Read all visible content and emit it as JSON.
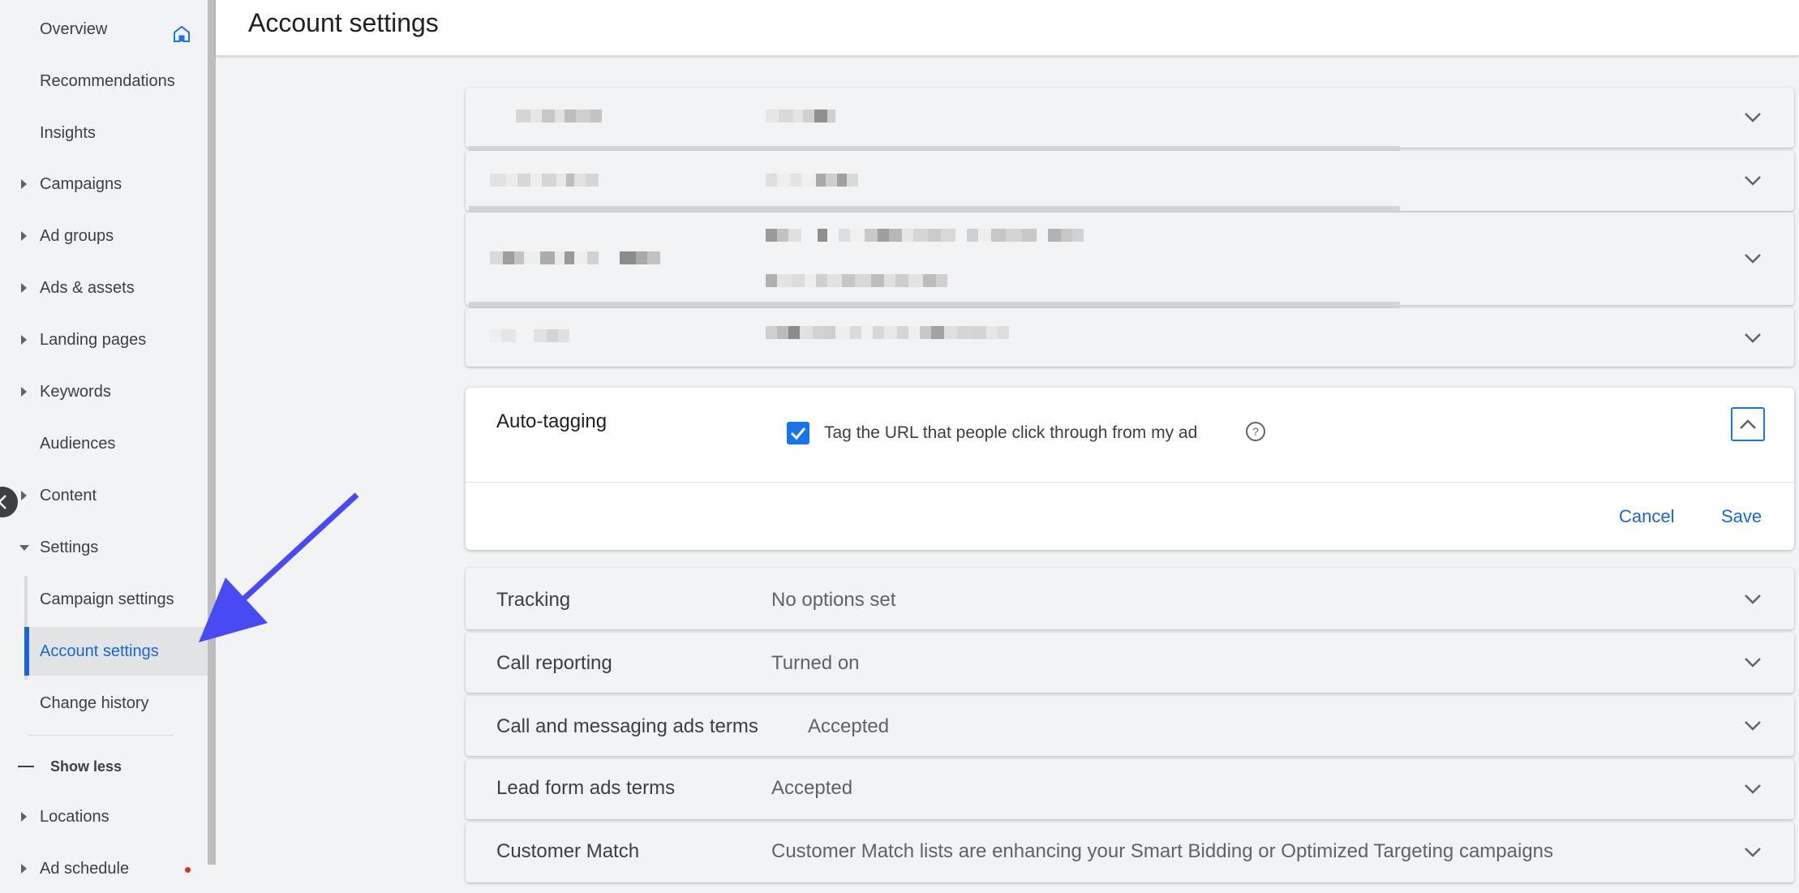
{
  "sidebar": {
    "items": [
      {
        "label": "Overview",
        "icon": "home-icon"
      },
      {
        "label": "Recommendations"
      },
      {
        "label": "Insights"
      },
      {
        "label": "Campaigns"
      },
      {
        "label": "Ad groups"
      },
      {
        "label": "Ads & assets"
      },
      {
        "label": "Landing pages"
      },
      {
        "label": "Keywords"
      },
      {
        "label": "Audiences"
      },
      {
        "label": "Content"
      },
      {
        "label": "Settings"
      }
    ],
    "settings_sub": [
      {
        "label": "Campaign settings"
      },
      {
        "label": "Account settings",
        "active": true
      },
      {
        "label": "Change history"
      }
    ],
    "show_less": "Show less",
    "more_items": [
      {
        "label": "Locations"
      },
      {
        "label": "Ad schedule"
      }
    ]
  },
  "header": {
    "title": "Account settings"
  },
  "auto_tagging": {
    "label": "Auto-tagging",
    "checkbox_label": "Tag the URL that people click through from my ad",
    "checked": true,
    "cancel": "Cancel",
    "save": "Save"
  },
  "settings_rows": [
    {
      "label": "Tracking",
      "value": "No options set"
    },
    {
      "label": "Call reporting",
      "value": "Turned on"
    },
    {
      "label": "Call and messaging ads terms",
      "value": "Accepted"
    },
    {
      "label": "Lead form ads terms",
      "value": "Accepted"
    },
    {
      "label": "Customer Match",
      "value": "Customer Match lists are enhancing your Smart Bidding or Optimized Targeting campaigns"
    }
  ],
  "colors": {
    "accent": "#1a73e8",
    "link": "#1967d2",
    "background": "#f1f3f4",
    "annotation_arrow": "#4a4af4"
  }
}
